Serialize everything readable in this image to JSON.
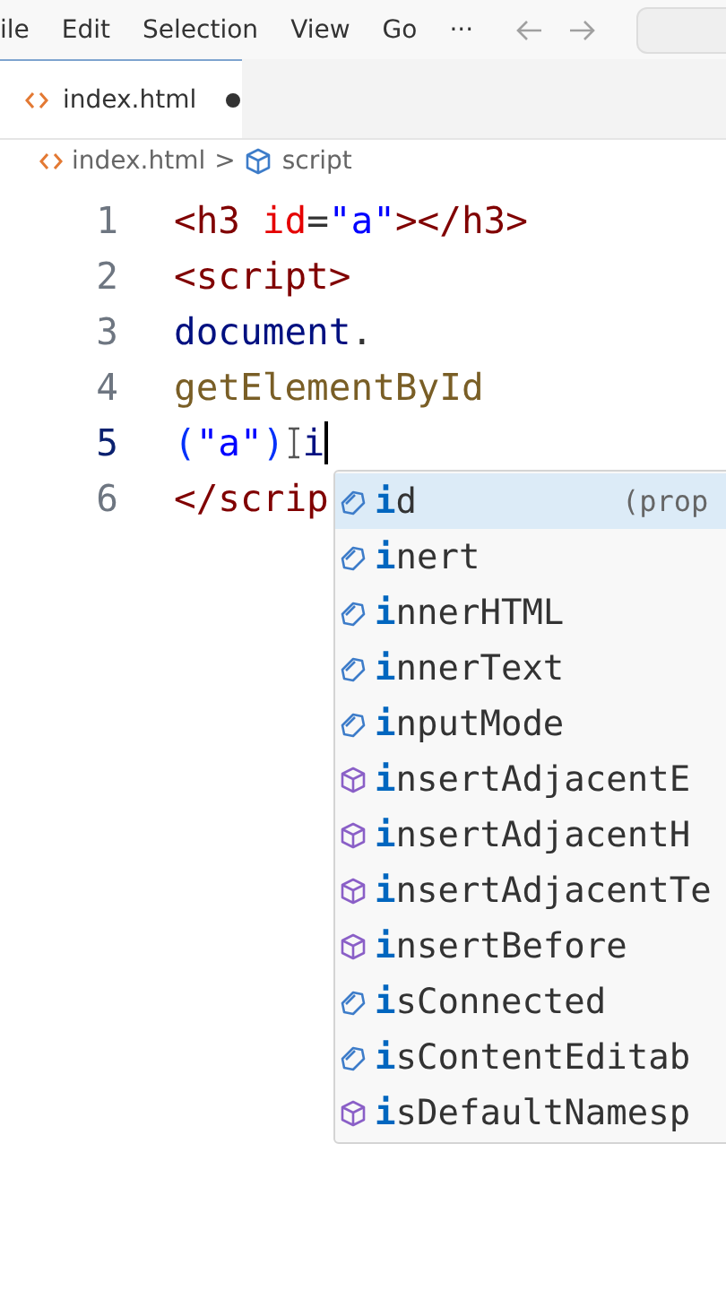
{
  "menu_bar": {
    "items": [
      "ile",
      "Edit",
      "Selection",
      "View",
      "Go",
      "···"
    ]
  },
  "tabs": [
    {
      "label": "index.html",
      "selected": true,
      "modified": true
    }
  ],
  "breadcrumb": {
    "file": "index.html",
    "separator": ">",
    "symbol": "script"
  },
  "editor": {
    "lines": [
      {
        "number": "1",
        "active": false,
        "tokens": [
          {
            "kind": "tag",
            "text": "<h3 "
          },
          {
            "kind": "attr",
            "text": "id"
          },
          {
            "kind": "plain",
            "text": "="
          },
          {
            "kind": "string",
            "text": "\"a\""
          },
          {
            "kind": "tag",
            "text": "></h3>"
          }
        ]
      },
      {
        "number": "2",
        "active": false,
        "tokens": [
          {
            "kind": "tag",
            "text": "<script>"
          }
        ]
      },
      {
        "number": "3",
        "active": false,
        "tokens": [
          {
            "kind": "variable",
            "text": "document"
          },
          {
            "kind": "plain",
            "text": "."
          }
        ]
      },
      {
        "number": "4",
        "active": false,
        "tokens": [
          {
            "kind": "function",
            "text": "getElementById"
          }
        ]
      },
      {
        "number": "5",
        "active": true,
        "tokens": [
          {
            "kind": "paren",
            "text": "("
          },
          {
            "kind": "string",
            "text": "\"a\""
          },
          {
            "kind": "paren",
            "text": ")"
          },
          {
            "kind": "pointer"
          },
          {
            "kind": "variable",
            "text": "i"
          },
          {
            "kind": "caret"
          }
        ]
      },
      {
        "number": "6",
        "active": false,
        "tokens": [
          {
            "kind": "tag",
            "text": "</scrip"
          }
        ]
      }
    ]
  },
  "suggestions": {
    "detail": "(prop",
    "items": [
      {
        "label": "**i**d",
        "kind": "property",
        "selected": true
      },
      {
        "label": "**i**nert",
        "kind": "property",
        "selected": false
      },
      {
        "label": "**i**nnerHTML",
        "kind": "property",
        "selected": false
      },
      {
        "label": "**i**nnerText",
        "kind": "property",
        "selected": false
      },
      {
        "label": "**i**nputMode",
        "kind": "property",
        "selected": false
      },
      {
        "label": "**i**nsertAdjacentE",
        "kind": "method",
        "selected": false
      },
      {
        "label": "**i**nsertAdjacentH",
        "kind": "method",
        "selected": false
      },
      {
        "label": "**i**nsertAdjacentTe",
        "kind": "method",
        "selected": false
      },
      {
        "label": "**i**nsertBefore",
        "kind": "method",
        "selected": false
      },
      {
        "label": "**i**sConnected",
        "kind": "property",
        "selected": false
      },
      {
        "label": "**i**sContentEditab",
        "kind": "property",
        "selected": false
      },
      {
        "label": "**i**sDefaultNamesp",
        "kind": "method",
        "selected": false
      }
    ]
  }
}
